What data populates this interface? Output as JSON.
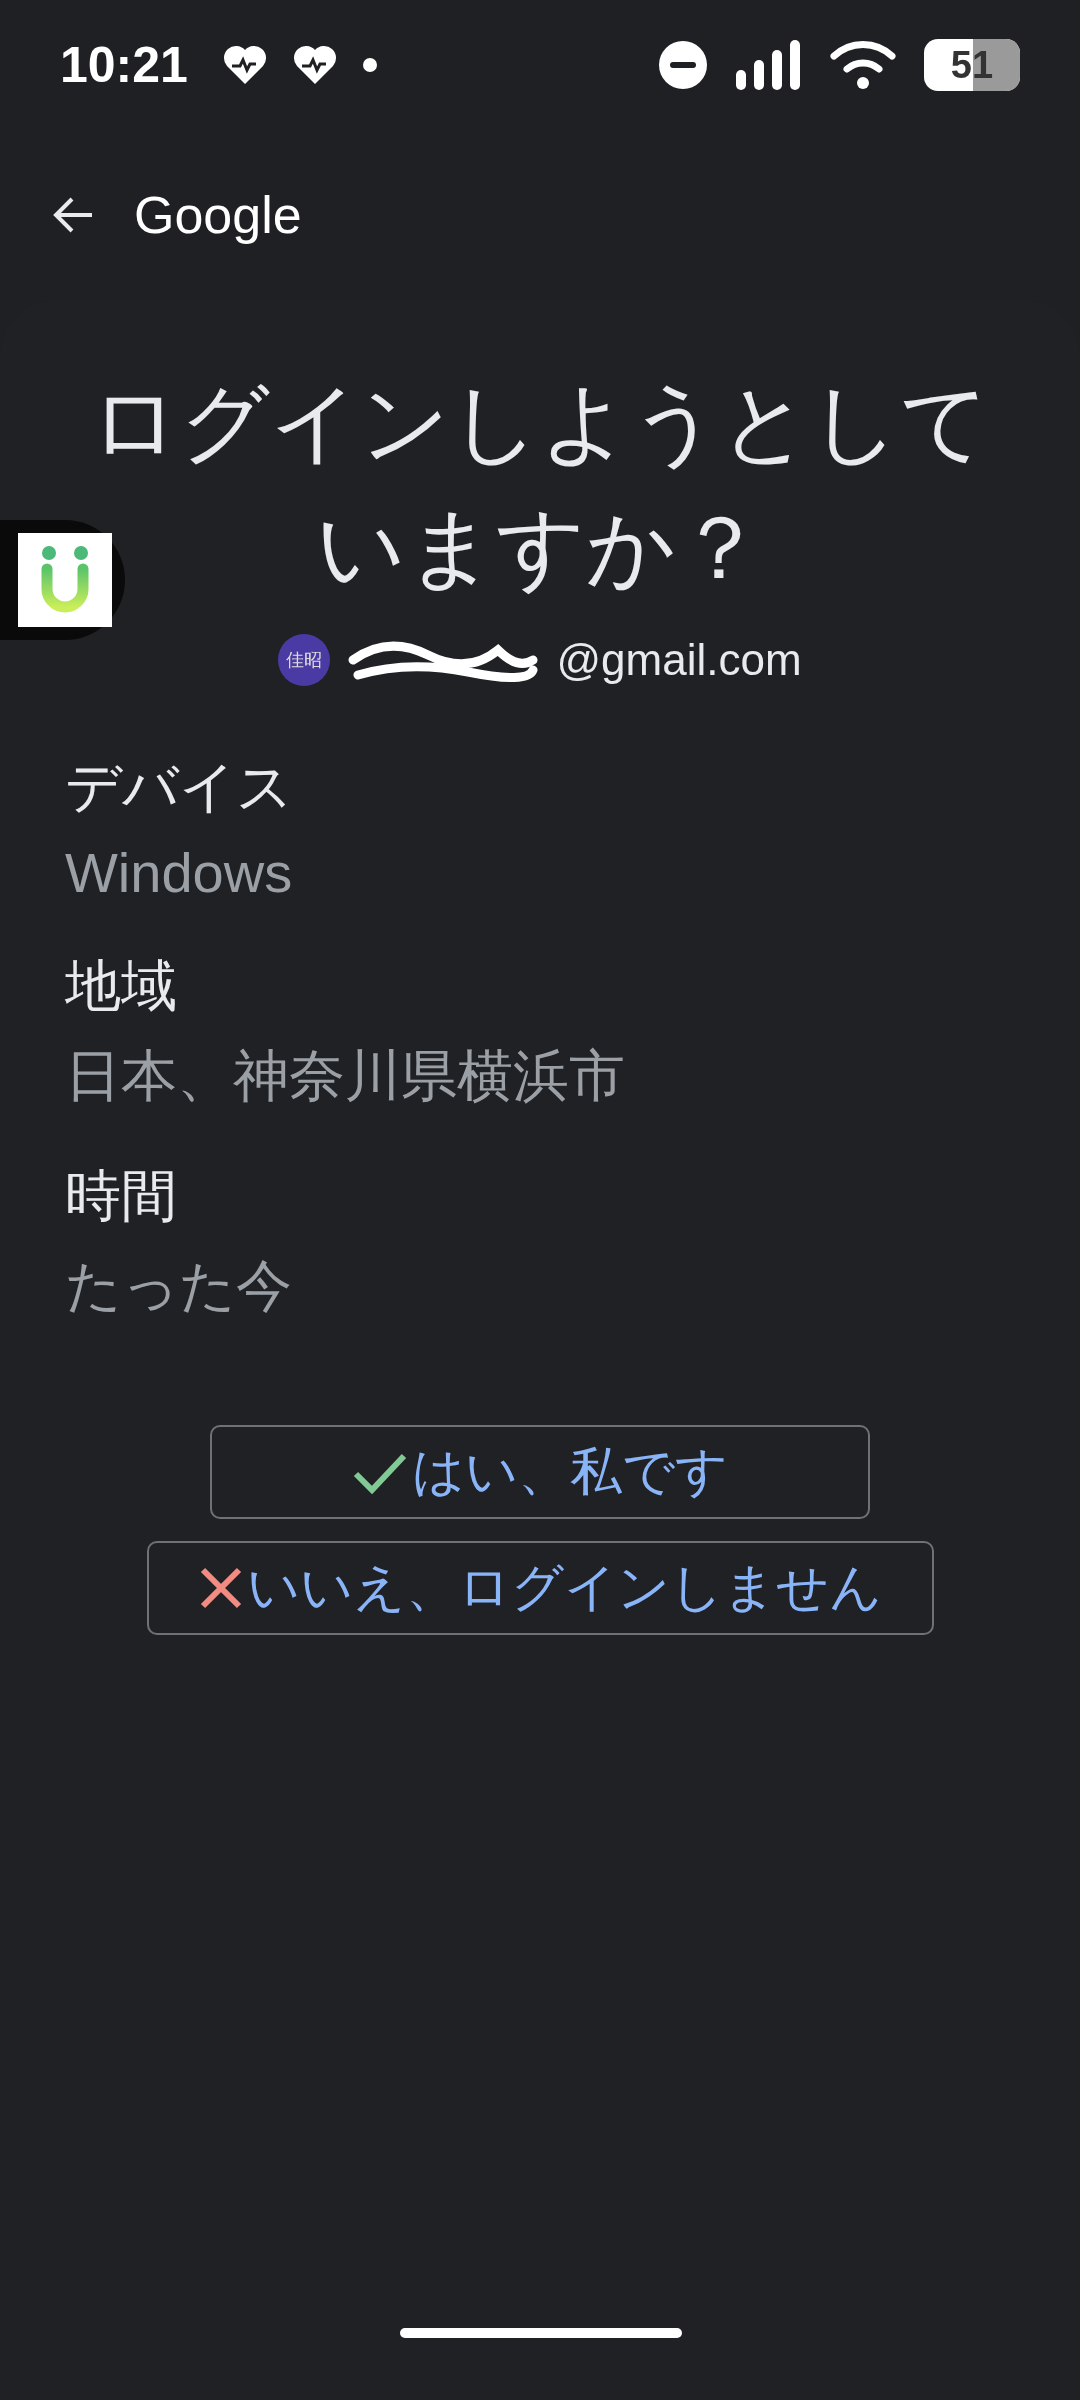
{
  "status_bar": {
    "time": "10:21",
    "battery": "51"
  },
  "header": {
    "title": "Google"
  },
  "prompt": {
    "title_lines": [
      "ログインしようとして",
      "いますか？"
    ],
    "avatar_text": "佳昭",
    "email": "@gmail.com"
  },
  "details": [
    {
      "label": "デバイス",
      "value": "Windows"
    },
    {
      "label": "地域",
      "value": "日本、神奈川県横浜市"
    },
    {
      "label": "時間",
      "value": "たった今"
    }
  ],
  "actions": [
    {
      "kind": "confirm",
      "label": "はい、私です"
    },
    {
      "kind": "deny",
      "label": "いいえ、ログインしません"
    }
  ]
}
